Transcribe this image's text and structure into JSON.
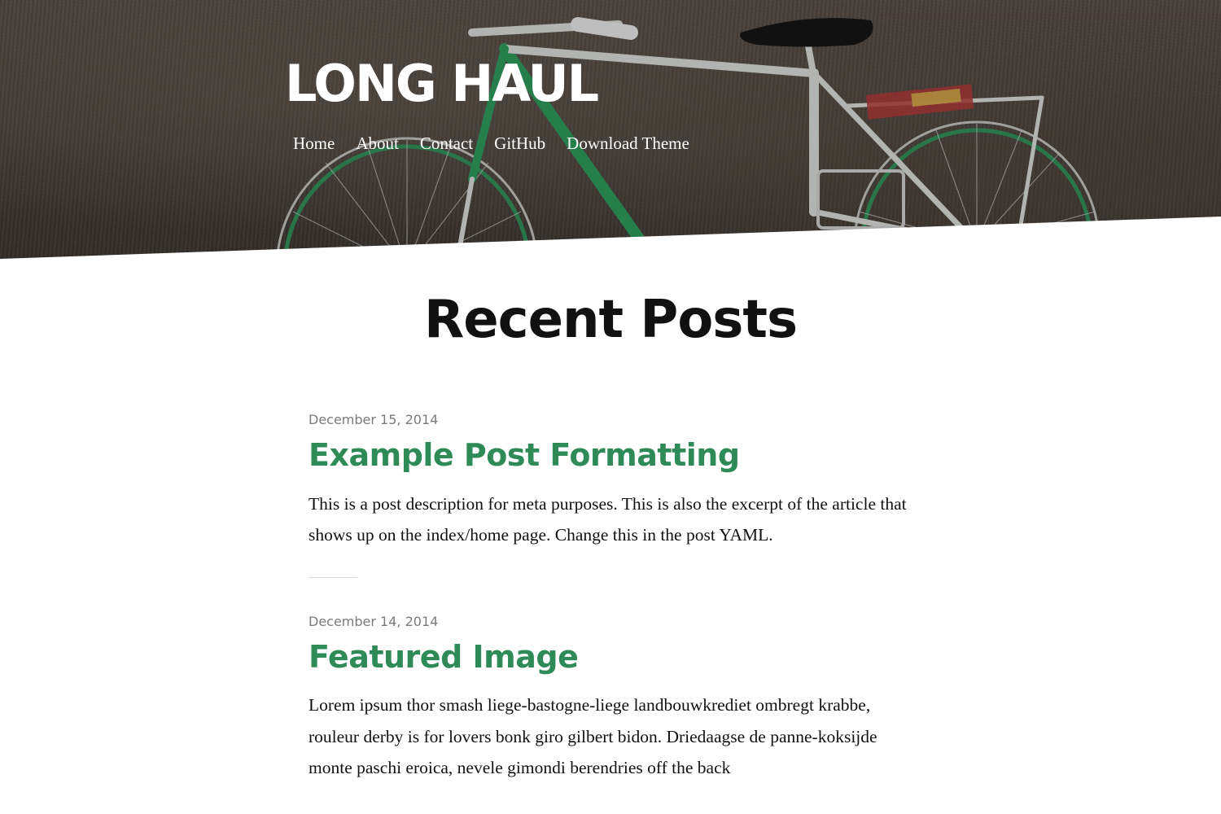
{
  "site": {
    "title": "LONG HAUL"
  },
  "nav": {
    "items": [
      {
        "label": "Home"
      },
      {
        "label": "About"
      },
      {
        "label": "Contact"
      },
      {
        "label": "GitHub"
      },
      {
        "label": "Download Theme"
      }
    ]
  },
  "main": {
    "heading": "Recent Posts",
    "posts": [
      {
        "date": "December 15, 2014",
        "title": "Example Post Formatting",
        "excerpt": "This is a post description for meta purposes. This is also the excerpt of the article that shows up on the index/home page. Change this in the post YAML."
      },
      {
        "date": "December 14, 2014",
        "title": "Featured Image",
        "excerpt": "Lorem ipsum thor smash liege-bastogne-liege landbouwkrediet ombregt krabbe, rouleur derby is for lovers bonk giro gilbert bidon. Driedaagse de panne-koksijde monte paschi eroica, nevele gimondi berendries off the back"
      }
    ]
  },
  "colors": {
    "accent": "#2e8b57",
    "heading": "#111111",
    "meta": "#7a7a7a",
    "bike_frame": "#2f9a5c"
  },
  "hero_image": "bicycle-against-wall"
}
